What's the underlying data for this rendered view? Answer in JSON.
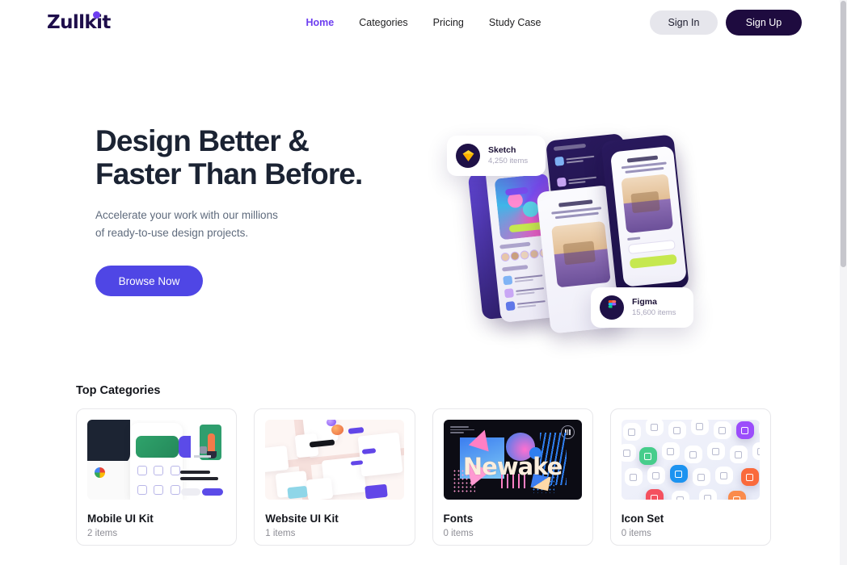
{
  "header": {
    "logo": "Zullkit",
    "nav": [
      {
        "label": "Home",
        "active": true
      },
      {
        "label": "Categories",
        "active": false
      },
      {
        "label": "Pricing",
        "active": false
      },
      {
        "label": "Study Case",
        "active": false
      }
    ],
    "sign_in": "Sign In",
    "sign_up": "Sign Up"
  },
  "hero": {
    "title_line1": "Design Better &",
    "title_line2": "Faster Than Before.",
    "subtitle_line1": "Accelerate your work with our millions",
    "subtitle_line2": "of ready-to-use design projects.",
    "cta": "Browse Now",
    "chips": [
      {
        "name": "Sketch",
        "count": "4,250 items",
        "icon": "sketch-icon"
      },
      {
        "name": "Figma",
        "count": "15,600 items",
        "icon": "figma-icon"
      }
    ]
  },
  "categories": {
    "title": "Top Categories",
    "items": [
      {
        "name": "Mobile UI Kit",
        "count": "2 items",
        "thumb": "mobile-ui-kit-thumbnail"
      },
      {
        "name": "Website UI Kit",
        "count": "1 items",
        "thumb": "website-ui-kit-thumbnail"
      },
      {
        "name": "Fonts",
        "count": "0 items",
        "thumb": "fonts-thumbnail",
        "poster_text": "Newake"
      },
      {
        "name": "Icon Set",
        "count": "0 items",
        "thumb": "icon-set-thumbnail"
      }
    ]
  },
  "colors": {
    "accent_purple": "#6d3ef0",
    "cta_purple": "#4f46e5",
    "dark_navy": "#1e0b3f",
    "heading": "#1b2333",
    "muted_text": "#8d8d95",
    "signin_bg": "#e6e6ec"
  }
}
